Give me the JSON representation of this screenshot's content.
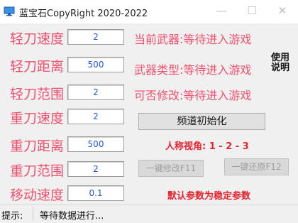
{
  "window": {
    "title": "蓝宝石CopyRight 2020-2022",
    "minimize_glyph": "—",
    "maximize_glyph": "☐",
    "close_glyph": "✕"
  },
  "settings": [
    {
      "label": "轻刀速度",
      "value": "2"
    },
    {
      "label": "轻刀距离",
      "value": "500"
    },
    {
      "label": "轻刀范围",
      "value": "2"
    },
    {
      "label": "重刀速度",
      "value": "2"
    },
    {
      "label": "重刀距离",
      "value": "500"
    },
    {
      "label": "重刀范围",
      "value": "2"
    },
    {
      "label": "移动速度",
      "value": "0.1"
    }
  ],
  "info": {
    "current_weapon": "当前武器:等待进入游戏",
    "weapon_type": "武器类型:等待进入游戏",
    "modifiable": "可否修改:等待进入游戏"
  },
  "help": {
    "line1": "使用",
    "line2": "说明"
  },
  "buttons": {
    "channel_init": "频道初始化",
    "one_key_modify": "一键修改F11",
    "one_key_restore": "一键还原F12"
  },
  "perspective": "人称视角: 1 - 2 - 3",
  "default_note": "默认参数为稳定参数",
  "status": {
    "label": "提示:",
    "text": "等待数据进行..."
  },
  "colors": {
    "label": "#f0506e",
    "value": "#1e57d6",
    "alert": "#e8232f"
  }
}
